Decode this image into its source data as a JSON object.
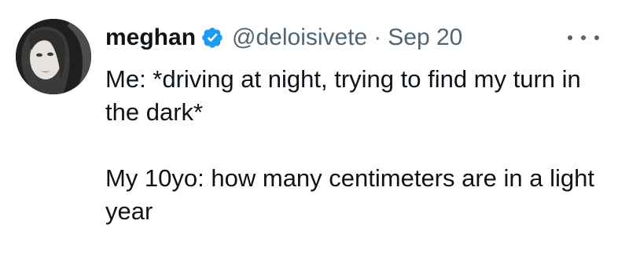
{
  "tweet": {
    "display_name": "meghan",
    "handle": "@deloisivete",
    "separator": "·",
    "date": "Sep 20",
    "paragraphs": [
      "Me: *driving at night, trying to find my turn in the dark*",
      "My 10yo: how many centimeters are in a light year"
    ]
  },
  "icons": {
    "verified": "verified-badge-icon",
    "more": "more-options-icon",
    "avatar": "profile-photo"
  },
  "colors": {
    "text": "#0f1419",
    "secondary_text": "#536471",
    "verified_badge": "#1d9bf0"
  }
}
